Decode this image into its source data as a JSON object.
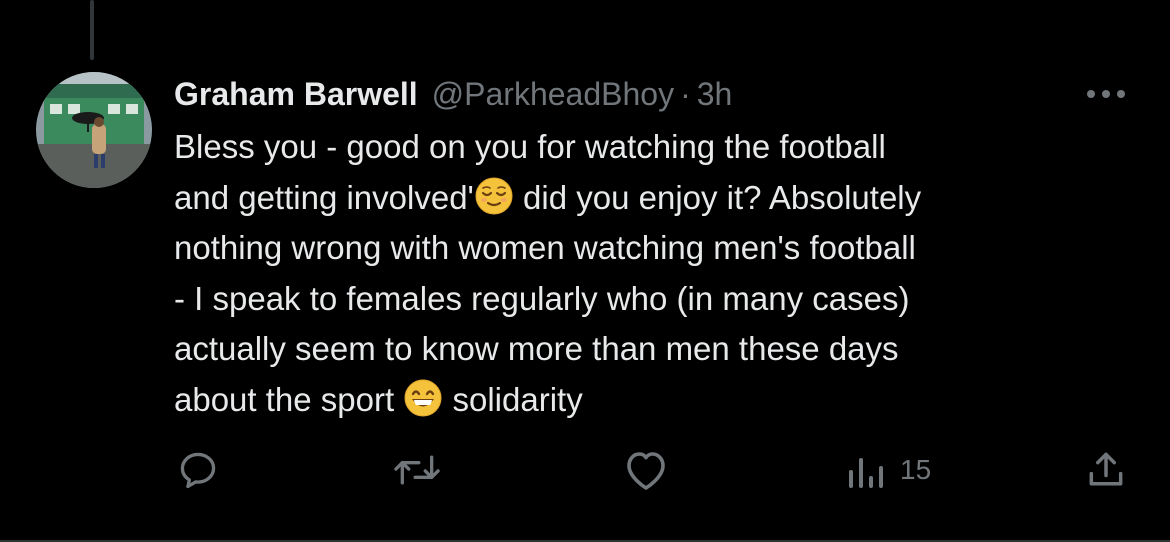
{
  "reply": {
    "author": {
      "display_name": "Graham Barwell",
      "handle": "@ParkheadBhoy",
      "avatar_icon": "avatar-photo-stadium-umbrella"
    },
    "separator": "·",
    "timestamp": "3h",
    "more_icon": "more-horizontal-icon",
    "text_lines": [
      "Bless you - good on you for watching the football",
      "and getting involved'",
      "did you enjoy it? Absolutely",
      "nothing wrong with women watching men's football",
      "- I speak to females regularly who (in many cases)",
      "actually seem to know more than men these days",
      "about the sport",
      "solidarity"
    ],
    "emojis": [
      "relieved-face-emoji",
      "grinning-face-emoji"
    ],
    "actions": {
      "reply_icon": "reply-icon",
      "retweet_icon": "retweet-icon",
      "like_icon": "heart-icon",
      "views_icon": "views-chart-icon",
      "views_count": "15",
      "share_icon": "share-icon"
    },
    "colors": {
      "background": "#000000",
      "text": "#e7e9ea",
      "muted": "#71767b",
      "divider": "#2f3336"
    }
  }
}
